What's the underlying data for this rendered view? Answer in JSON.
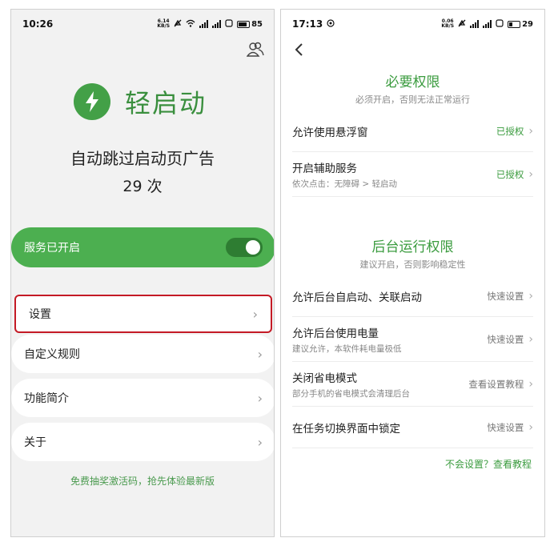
{
  "left": {
    "status": {
      "time": "10:26",
      "speed_top": "6.14",
      "speed_bottom": "KB/S",
      "battery": "85"
    },
    "app_name": "轻启动",
    "headline": "自动跳过启动页广告",
    "count": "29 次",
    "service": {
      "label": "服务已开启",
      "enabled": true
    },
    "menu": [
      {
        "label": "设置"
      },
      {
        "label": "自定义规则"
      },
      {
        "label": "功能简介"
      },
      {
        "label": "关于"
      }
    ],
    "promo": "免费抽奖激活码，抢先体验最新版",
    "accent": "#4caf50",
    "highlight": "#c41a25"
  },
  "right": {
    "status": {
      "time": "17:13",
      "speed_top": "0.06",
      "speed_bottom": "KB/S",
      "battery": "29"
    },
    "required": {
      "title": "必要权限",
      "subtitle": "必须开启，否则无法正常运行",
      "items": [
        {
          "title": "允许使用悬浮窗",
          "desc": "",
          "status": "已授权"
        },
        {
          "title": "开启辅助服务",
          "desc": "依次点击：无障碍 > 轻启动",
          "status": "已授权"
        }
      ]
    },
    "background": {
      "title": "后台运行权限",
      "subtitle": "建议开启，否则影响稳定性",
      "items": [
        {
          "title": "允许后台自启动、关联启动",
          "desc": "",
          "status": "快速设置"
        },
        {
          "title": "允许后台使用电量",
          "desc": "建议允许，本软件耗电量极低",
          "status": "快速设置"
        },
        {
          "title": "关闭省电模式",
          "desc": "部分手机的省电模式会清理后台",
          "status": "查看设置教程"
        },
        {
          "title": "在任务切换界面中锁定",
          "desc": "",
          "status": "快速设置"
        }
      ]
    },
    "help_link": "不会设置？查看教程"
  },
  "icons": {
    "chevron": "›",
    "back": "‹"
  }
}
